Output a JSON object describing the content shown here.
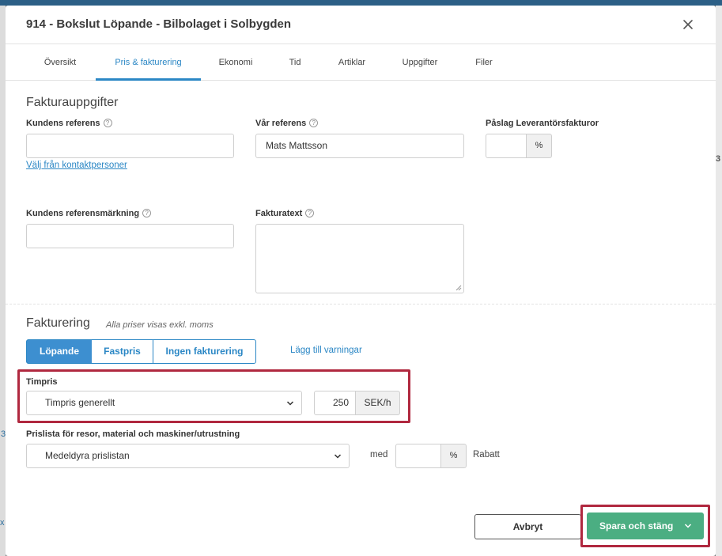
{
  "modal": {
    "title": "914 - Bokslut Löpande - Bilbolaget i Solbygden"
  },
  "tabs": [
    {
      "label": "Översikt"
    },
    {
      "label": "Pris & fakturering"
    },
    {
      "label": "Ekonomi"
    },
    {
      "label": "Tid"
    },
    {
      "label": "Artiklar"
    },
    {
      "label": "Uppgifter"
    },
    {
      "label": "Filer"
    }
  ],
  "fakturauppgifter": {
    "title": "Fakturauppgifter",
    "kundens_referens": {
      "label": "Kundens referens",
      "value": ""
    },
    "valj_kontakt_link": "Välj från kontaktpersoner",
    "var_referens": {
      "label": "Vår referens",
      "value": "Mats Mattsson"
    },
    "paslag": {
      "label": "Påslag Leverantörsfakturor",
      "value": "",
      "unit": "%"
    },
    "referensmarkning": {
      "label": "Kundens referensmärkning",
      "value": ""
    },
    "fakturatext": {
      "label": "Fakturatext",
      "value": ""
    },
    "help_glyph": "?"
  },
  "fakturering": {
    "title": "Fakturering",
    "subtitle": "Alla priser visas exkl. moms",
    "modes": [
      {
        "label": "Löpande",
        "active": true
      },
      {
        "label": "Fastpris",
        "active": false
      },
      {
        "label": "Ingen fakturering",
        "active": false
      }
    ],
    "add_warnings_link": "Lägg till varningar",
    "timpris": {
      "label": "Timpris",
      "select_value": "Timpris generellt",
      "amount": "250",
      "unit": "SEK/h"
    },
    "prislista": {
      "label": "Prislista för resor, material och maskiner/utrustning",
      "select_value": "Medeldyra prislistan",
      "med_label": "med",
      "discount_value": "",
      "discount_unit": "%",
      "rabatt_label": "Rabatt"
    }
  },
  "footer": {
    "cancel_label": "Avbryt",
    "save_label": "Spara och stäng"
  },
  "background": {
    "fragment_3": "3",
    "fragment_x": "x"
  },
  "colors": {
    "accent": "#2b87c5",
    "save": "#4bae82",
    "highlight": "#b0283f"
  }
}
